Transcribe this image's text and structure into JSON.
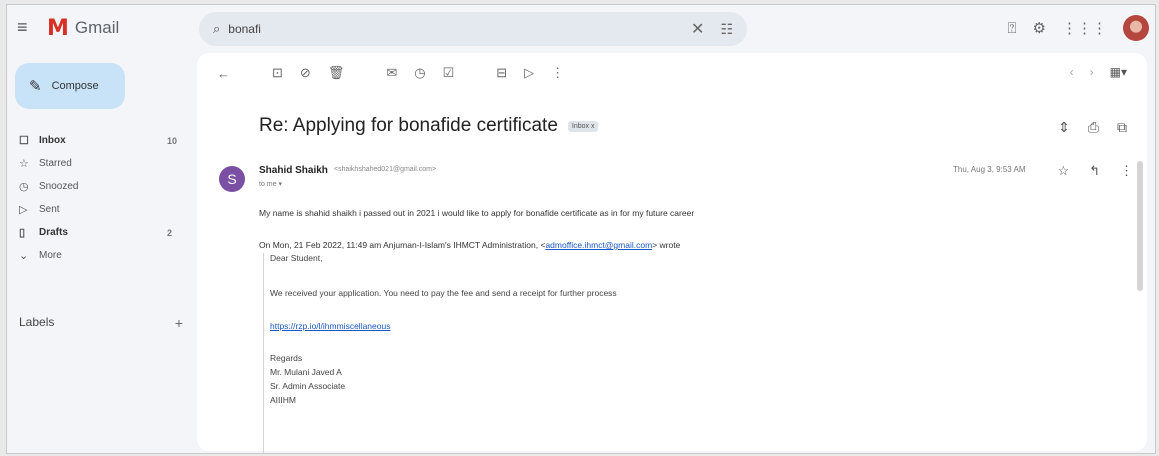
{
  "app": {
    "name": "Gmail"
  },
  "search": {
    "value": "bonafi"
  },
  "sidebar": {
    "compose_label": "Compose",
    "items": [
      {
        "label": "Inbox",
        "count": "10",
        "icon": "inbox-icon"
      },
      {
        "label": "Starred",
        "count": "",
        "icon": "star-icon"
      },
      {
        "label": "Snoozed",
        "count": "",
        "icon": "clock-icon"
      },
      {
        "label": "Sent",
        "count": "",
        "icon": "send-icon"
      },
      {
        "label": "Drafts",
        "count": "2",
        "icon": "draft-icon"
      },
      {
        "label": "More",
        "count": "",
        "icon": "chevron-down-icon"
      }
    ],
    "labels_heading": "Labels"
  },
  "message": {
    "subject": "Re: Applying for bonafide certificate",
    "badge": "Inbox x",
    "sender_initial": "S",
    "sender_name": "Shahid Shaikh",
    "sender_email": "<shaikhshahed021@gmail.com>",
    "to_me": "to me ▾",
    "date": "Thu, Aug 3, 9:53 AM",
    "body": "My name is shahid shaikh i passed out in 2021 i would like to apply for bonafide certificate as in for my future career",
    "quote_intro": "On Mon, 21 Feb 2022, 11:49 am Anjuman-I-Islam's IHMCT Administration, <",
    "quote_email": "admoffice.ihmct@gmail.com",
    "quote_outro": "> wrote",
    "quote": {
      "greeting": "Dear Student,",
      "line1": "We received your application. You need to pay the fee and send a receipt for further process",
      "link": "https://rzp.io/l/ihmmiscellaneous",
      "regards": "Regards",
      "name": "Mr. Mulani Javed A",
      "title": "Sr. Admin Associate",
      "org": "AIIIHM"
    }
  }
}
